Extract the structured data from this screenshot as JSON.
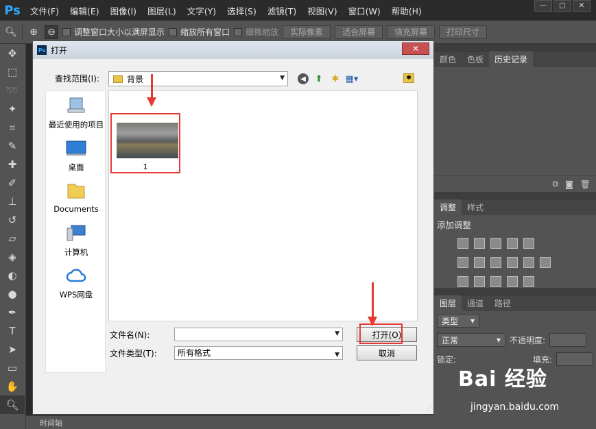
{
  "menubar": {
    "logo": "Ps",
    "items": [
      "文件(F)",
      "编辑(E)",
      "图像(I)",
      "图层(L)",
      "文字(Y)",
      "选择(S)",
      "滤镜(T)",
      "视图(V)",
      "窗口(W)",
      "帮助(H)"
    ],
    "window_controls": [
      "—",
      "□",
      "✕"
    ]
  },
  "options_bar": {
    "resize_window_label": "调整窗口大小以满屏显示",
    "zoom_all_windows_label": "缩放所有窗口",
    "scrubby_zoom_label": "细微缩放",
    "actual_pixels_label": "实际像素",
    "fit_screen_label": "适合屏幕",
    "fill_screen_label": "填充屏幕",
    "print_size_label": "打印尺寸"
  },
  "panels": {
    "top_tabs": [
      "颜色",
      "色板",
      "历史记录"
    ],
    "adjust_tabs": [
      "调整",
      "样式"
    ],
    "adjust_title": "添加调整",
    "layers_tabs": [
      "图层",
      "通道",
      "路径"
    ],
    "kind_label": "类型",
    "blend_mode": "正常",
    "opacity_label": "不透明度:",
    "lock_label": "锁定:",
    "fill_label": "填充:"
  },
  "timeline": {
    "label": "时间轴"
  },
  "dialog": {
    "title": "打开",
    "close_label": "✕",
    "lookin_label": "查找范围(I):",
    "lookin_value": "背景",
    "places": [
      "最近使用的项目",
      "桌面",
      "Documents",
      "计算机",
      "WPS网盘"
    ],
    "file_name": "1",
    "filename_label": "文件名(N):",
    "filename_value": "",
    "filetype_label": "文件类型(T):",
    "filetype_value": "所有格式",
    "open_label": "打开(O)",
    "cancel_label": "取消"
  },
  "watermark": {
    "logo": "Bai 经验",
    "url": "jingyan.baidu.com"
  },
  "colors": {
    "highlight": "#e53935",
    "ps_bg": "#535353",
    "menubar_bg": "#2b2b2b"
  }
}
